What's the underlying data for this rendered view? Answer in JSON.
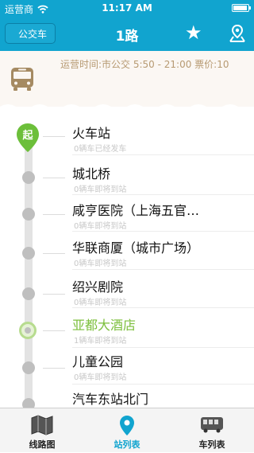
{
  "status_bar": {
    "carrier": "运营商",
    "time": "11:17 AM"
  },
  "nav": {
    "back_label": "公交车",
    "title": "1路",
    "favorite_icon": "star-icon",
    "map_icon": "map-pin-icon"
  },
  "info": {
    "text": "运营时间:市公交  5:50 - 21:00 票价:10"
  },
  "stops": [
    {
      "name": "火车站",
      "sub": "0辆车已经发车",
      "start": true,
      "start_label": "起"
    },
    {
      "name": "城北桥",
      "sub": "0辆车即将到站"
    },
    {
      "name": "咸亨医院（上海五官…",
      "sub": "0辆车即将到站"
    },
    {
      "name": "华联商厦（城市广场）",
      "sub": "0辆车即将到站"
    },
    {
      "name": "绍兴剧院",
      "sub": "0辆车即将到站"
    },
    {
      "name": "亚都大酒店",
      "sub": "1辆车即将到站",
      "current": true
    },
    {
      "name": "儿童公园",
      "sub": "0辆车即将到站"
    },
    {
      "name": "汽车东站北门",
      "sub": ""
    }
  ],
  "tabs": [
    {
      "label": "线路图",
      "icon": "map-icon",
      "active": false
    },
    {
      "label": "站列表",
      "icon": "location-pin-icon",
      "active": true
    },
    {
      "label": "车列表",
      "icon": "bus-icon",
      "active": false
    }
  ],
  "colors": {
    "primary": "#11a4cf",
    "current_stop": "#7cbf3c",
    "info_text": "#b79a72"
  }
}
